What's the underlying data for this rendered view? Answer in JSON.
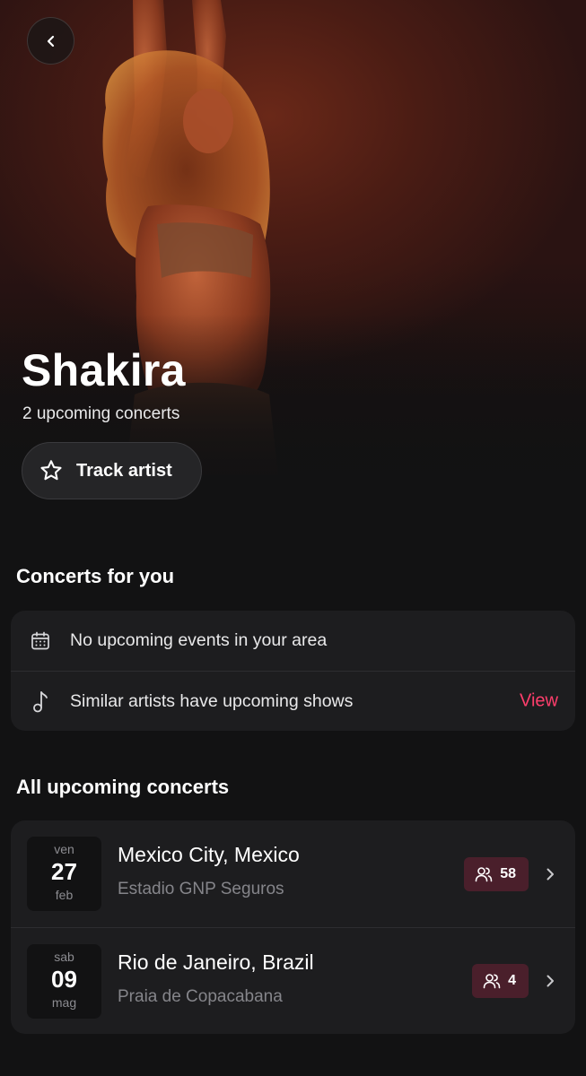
{
  "artist": {
    "name": "Shakira",
    "subtitle": "2 upcoming concerts",
    "track_label": "Track artist"
  },
  "sections": {
    "for_you": "Concerts for you",
    "all_upcoming": "All upcoming concerts"
  },
  "for_you_rows": [
    {
      "icon": "calendar-icon",
      "text": "No upcoming events in your area"
    },
    {
      "icon": "music-note-icon",
      "text": "Similar artists have upcoming shows",
      "action": "View"
    }
  ],
  "concerts": [
    {
      "weekday": "ven",
      "day": "27",
      "month": "feb",
      "city": "Mexico City, Mexico",
      "venue": "Estadio GNP Seguros",
      "attendees": "58"
    },
    {
      "weekday": "sab",
      "day": "09",
      "month": "mag",
      "city": "Rio de Janeiro, Brazil",
      "venue": "Praia de Copacabana",
      "attendees": "4"
    }
  ],
  "colors": {
    "background": "#121213",
    "card": "#1d1d1f",
    "accent": "#ff3e6c",
    "badge": "#4a1f2b"
  }
}
